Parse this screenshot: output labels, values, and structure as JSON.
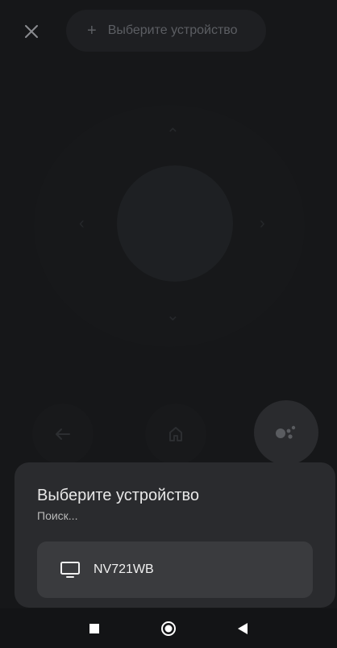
{
  "header": {
    "close_icon": "close-icon",
    "select_device_label": "Выберите устройство",
    "plus_icon": "plus-icon"
  },
  "remote": {
    "back_icon": "back-arrow-icon",
    "home_icon": "home-icon",
    "assistant_icon": "assistant-icon"
  },
  "sheet": {
    "title": "Выберите устройство",
    "subtitle": "Поиск...",
    "devices": [
      {
        "name": "NV721WB",
        "icon": "tv-icon"
      }
    ]
  },
  "system_nav": {
    "recent_icon": "square-icon",
    "home_icon": "circle-icon",
    "back_icon": "triangle-back-icon"
  },
  "colors": {
    "background": "#161719",
    "sheet": "#2a2b2e",
    "device_row": "#3a3b3e"
  }
}
